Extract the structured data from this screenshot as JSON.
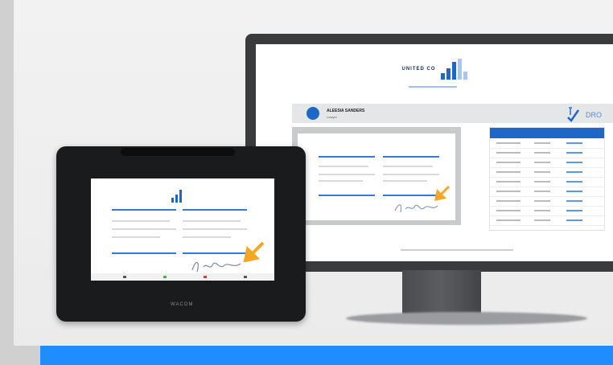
{
  "monitor_screen": {
    "company_name": "UNITED CO",
    "profile_name": "ALEESIA SANDERS",
    "profile_role": "Lawyer",
    "brand_text": "DRO"
  },
  "tablet": {
    "brand_label": "WACOM"
  },
  "colors": {
    "accent_blue": "#1f8cff",
    "logo_blue": "#1f66c9",
    "signature_arrow": "#f5a623"
  }
}
